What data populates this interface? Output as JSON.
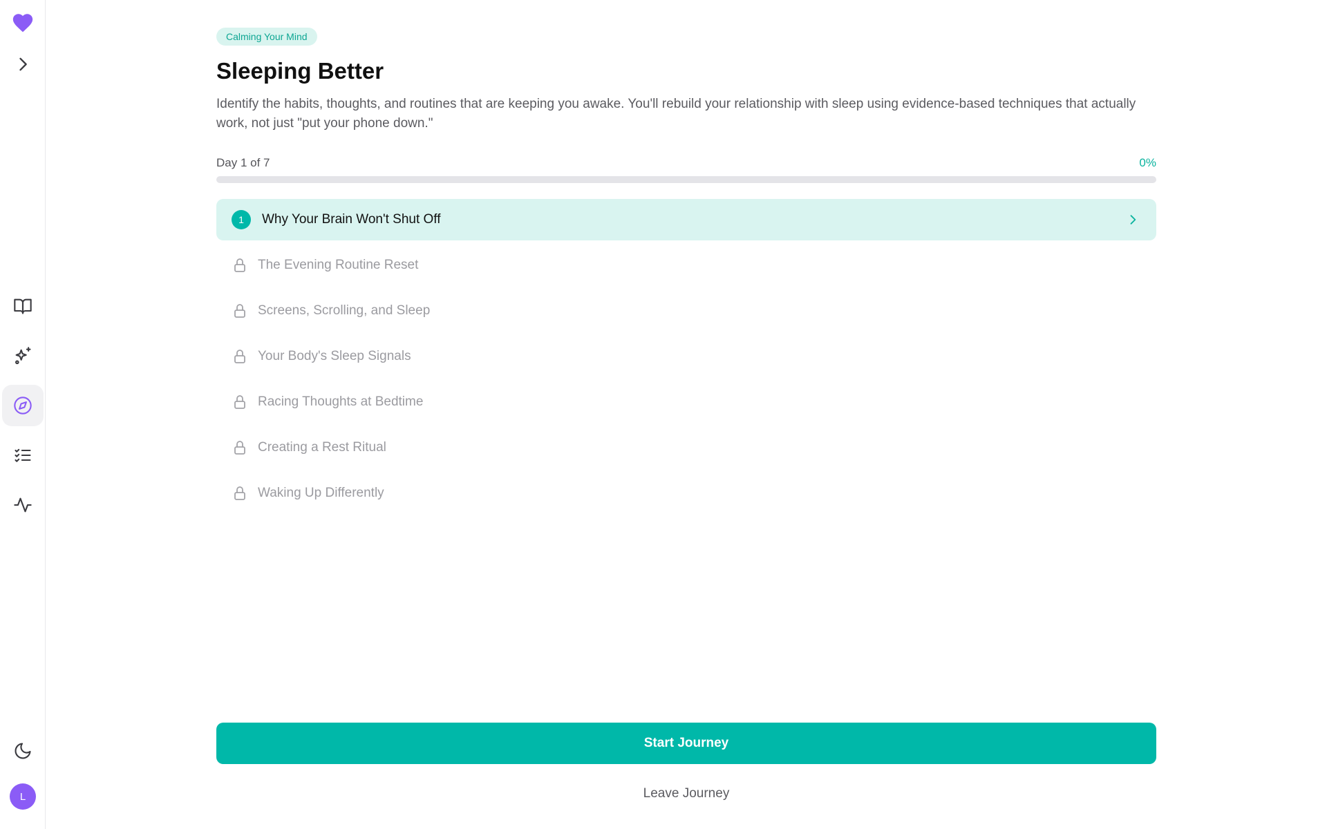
{
  "app": {
    "accent_color": "#8b5cf6",
    "teal_color": "#00b8a9"
  },
  "sidebar": {
    "logo_icon": "heart-icon",
    "expand_icon": "chevron-right-icon",
    "nav_items": [
      {
        "icon": "book-open-icon",
        "active": false
      },
      {
        "icon": "sparkles-icon",
        "active": false
      },
      {
        "icon": "compass-icon",
        "active": true
      },
      {
        "icon": "checklist-icon",
        "active": false
      },
      {
        "icon": "activity-icon",
        "active": false
      }
    ],
    "theme_icon": "moon-icon",
    "avatar_initial": "L"
  },
  "journey": {
    "category": "Calming Your Mind",
    "title": "Sleeping Better",
    "description": "Identify the habits, thoughts, and routines that are keeping you awake. You'll rebuild your relationship with sleep using evidence-based techniques that actually work, not just \"put your phone down.\"",
    "progress": {
      "label": "Day 1 of 7",
      "percent_label": "0%",
      "fraction": 0
    },
    "lessons": [
      {
        "number": "1",
        "title": "Why Your Brain Won't Shut Off",
        "state": "current"
      },
      {
        "title": "The Evening Routine Reset",
        "state": "locked"
      },
      {
        "title": "Screens, Scrolling, and Sleep",
        "state": "locked"
      },
      {
        "title": "Your Body's Sleep Signals",
        "state": "locked"
      },
      {
        "title": "Racing Thoughts at Bedtime",
        "state": "locked"
      },
      {
        "title": "Creating a Rest Ritual",
        "state": "locked"
      },
      {
        "title": "Waking Up Differently",
        "state": "locked"
      }
    ],
    "start_label": "Start Journey",
    "leave_label": "Leave Journey"
  }
}
